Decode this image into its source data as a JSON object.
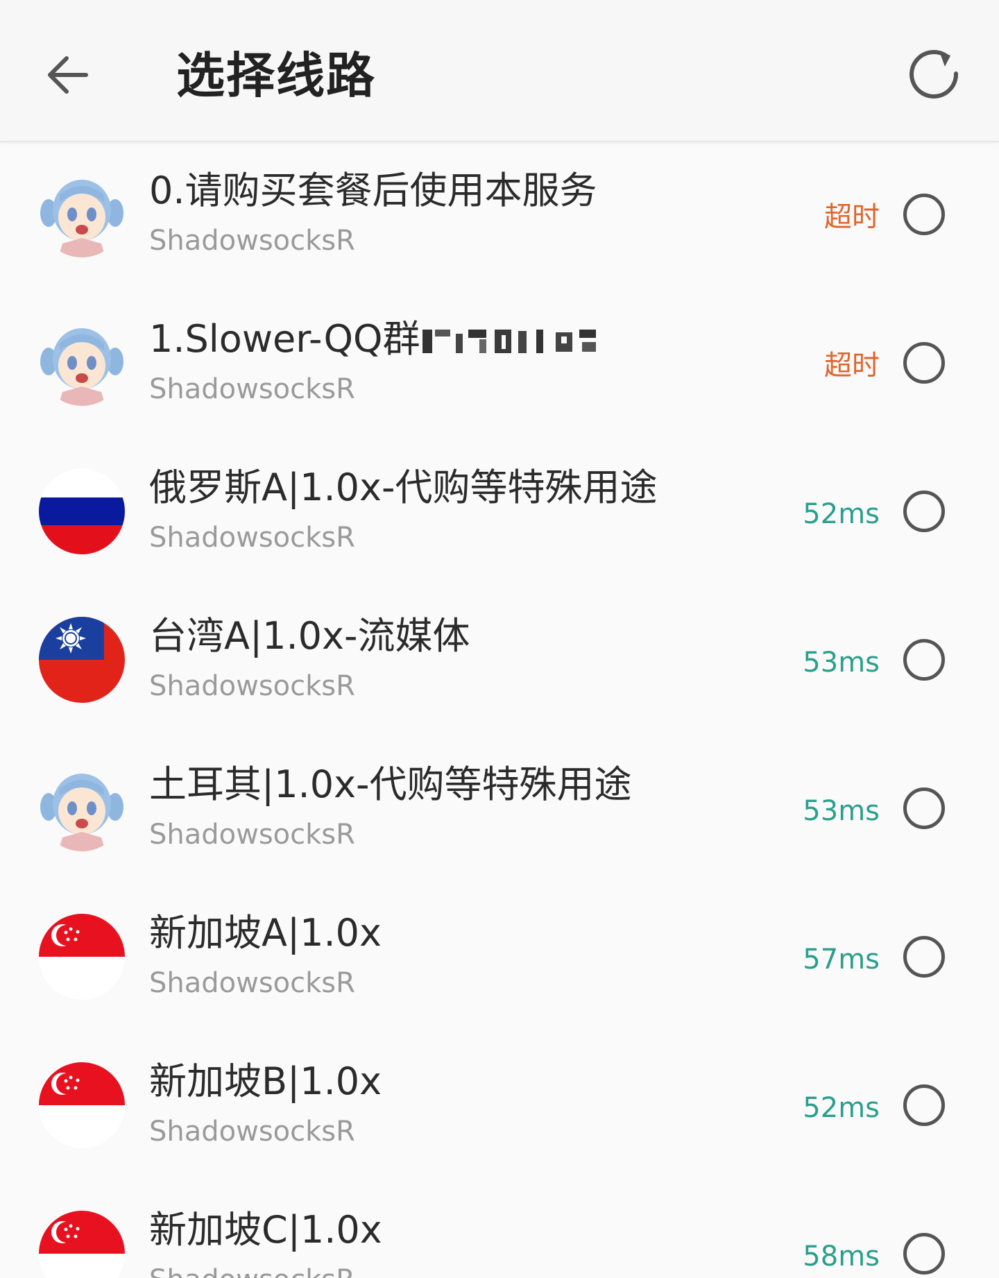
{
  "appbar": {
    "title": "选择线路",
    "back_icon": "arrow-left-icon",
    "refresh_icon": "refresh-icon"
  },
  "colors": {
    "timeout": "#e0652c",
    "ok": "#2a9f8c"
  },
  "servers": [
    {
      "name": "0.请购买套餐后使用本服务",
      "protocol": "ShadowsocksR",
      "latency": "超时",
      "icon": "anime-girl-avatar",
      "status": "timeout"
    },
    {
      "name": "1.Slower-QQ群",
      "protocol": "ShadowsocksR",
      "latency": "超时",
      "icon": "anime-girl-avatar",
      "status": "timeout"
    },
    {
      "name": "俄罗斯A|1.0x-代购等特殊用途",
      "protocol": "ShadowsocksR",
      "latency": "52ms",
      "icon": "russia-flag",
      "status": "ok"
    },
    {
      "name": "台湾A|1.0x-流媒体",
      "protocol": "ShadowsocksR",
      "latency": "53ms",
      "icon": "taiwan-flag",
      "status": "ok"
    },
    {
      "name": "土耳其|1.0x-代购等特殊用途",
      "protocol": "ShadowsocksR",
      "latency": "53ms",
      "icon": "anime-girl-avatar",
      "status": "ok"
    },
    {
      "name": "新加坡A|1.0x",
      "protocol": "ShadowsocksR",
      "latency": "57ms",
      "icon": "singapore-flag",
      "status": "ok"
    },
    {
      "name": "新加坡B|1.0x",
      "protocol": "ShadowsocksR",
      "latency": "52ms",
      "icon": "singapore-flag",
      "status": "ok"
    },
    {
      "name": "新加坡C|1.0x",
      "protocol": "ShadowsocksR",
      "latency": "58ms",
      "icon": "singapore-flag",
      "status": "ok"
    }
  ]
}
